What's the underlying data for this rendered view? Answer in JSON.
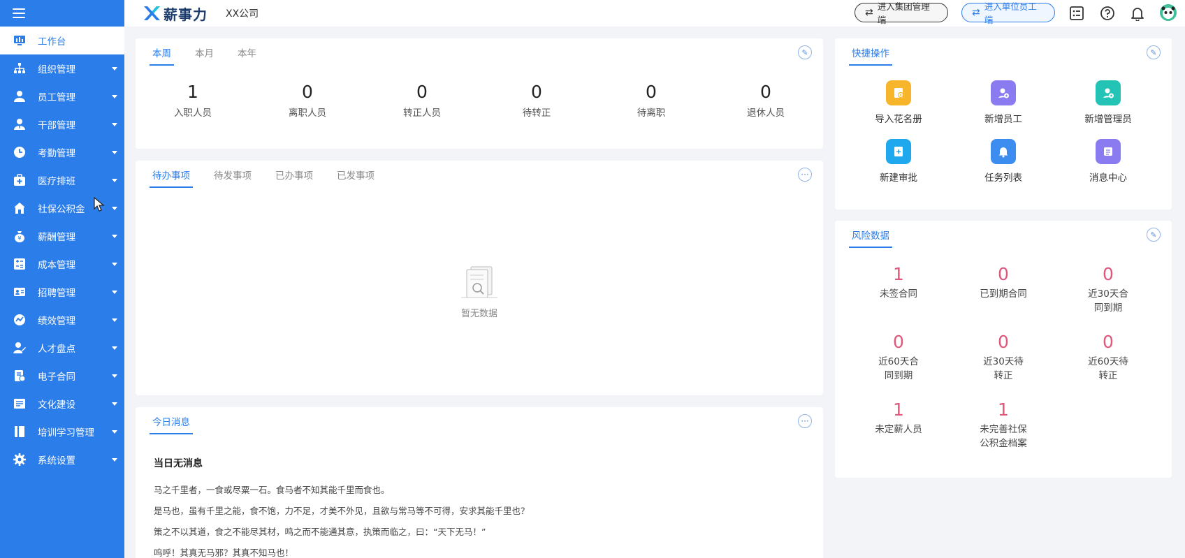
{
  "header": {
    "logo_text": "薪事力",
    "company": "XX公司",
    "btn_group": "进入集团管理端",
    "btn_unit": "进入单位员工端"
  },
  "sidebar": {
    "items": [
      {
        "label": "工作台",
        "icon": "dashboard-icon"
      },
      {
        "label": "组织管理",
        "icon": "org-chart-icon"
      },
      {
        "label": "员工管理",
        "icon": "user-icon"
      },
      {
        "label": "干部管理",
        "icon": "cadre-icon"
      },
      {
        "label": "考勤管理",
        "icon": "clock-icon"
      },
      {
        "label": "医疗排班",
        "icon": "medical-icon"
      },
      {
        "label": "社保公积金",
        "icon": "house-icon"
      },
      {
        "label": "薪酬管理",
        "icon": "money-bag-icon"
      },
      {
        "label": "成本管理",
        "icon": "calculator-icon"
      },
      {
        "label": "招聘管理",
        "icon": "recruit-icon"
      },
      {
        "label": "绩效管理",
        "icon": "performance-icon"
      },
      {
        "label": "人才盘点",
        "icon": "talent-icon"
      },
      {
        "label": "电子合同",
        "icon": "contract-icon"
      },
      {
        "label": "文化建设",
        "icon": "culture-icon"
      },
      {
        "label": "培训学习管理",
        "icon": "book-icon"
      },
      {
        "label": "系统设置",
        "icon": "gear-icon"
      }
    ]
  },
  "stats_card": {
    "tabs": [
      "本周",
      "本月",
      "本年"
    ],
    "items": [
      {
        "value": "1",
        "label": "入职人员"
      },
      {
        "value": "0",
        "label": "离职人员"
      },
      {
        "value": "0",
        "label": "转正人员"
      },
      {
        "value": "0",
        "label": "待转正"
      },
      {
        "value": "0",
        "label": "待离职"
      },
      {
        "value": "0",
        "label": "退休人员"
      }
    ]
  },
  "todo_card": {
    "tabs": [
      "待办事项",
      "待发事项",
      "已办事项",
      "已发事项"
    ],
    "empty_text": "暂无数据"
  },
  "message_card": {
    "tab": "今日消息",
    "title": "当日无消息",
    "lines": [
      "马之千里者，一食或尽粟一石。食马者不知其能千里而食也。",
      "是马也，虽有千里之能，食不饱，力不足，才美不外见，且欲与常马等不可得，安求其能千里也？",
      "策之不以其道，食之不能尽其材，鸣之而不能通其意，执策而临之，曰：“天下无马！”",
      "呜呼！其真无马邪？其真不知马也！"
    ]
  },
  "quick_card": {
    "tab": "快捷操作",
    "items": [
      {
        "label": "导入花名册",
        "color": "#f7b52c",
        "icon": "import-icon"
      },
      {
        "label": "新增员工",
        "color": "#8a7cf0",
        "icon": "add-user-icon"
      },
      {
        "label": "新增管理员",
        "color": "#23c3b6",
        "icon": "add-admin-icon"
      },
      {
        "label": "新建审批",
        "color": "#1fa8ee",
        "icon": "new-approval-icon"
      },
      {
        "label": "任务列表",
        "color": "#3d8cf0",
        "icon": "bell-icon"
      },
      {
        "label": "消息中心",
        "color": "#8a7cf0",
        "icon": "message-center-icon"
      }
    ]
  },
  "risk_card": {
    "tab": "风险数据",
    "items": [
      {
        "value": "1",
        "label": "未签合同"
      },
      {
        "value": "0",
        "label": "已到期合同"
      },
      {
        "value": "0",
        "label": "近30天合同到期"
      },
      {
        "value": "0",
        "label": "近60天合同到期"
      },
      {
        "value": "0",
        "label": "近30天待转正"
      },
      {
        "value": "0",
        "label": "近60天待转正"
      },
      {
        "value": "1",
        "label": "未定薪人员"
      },
      {
        "value": "1",
        "label": "未完善社保公积金档案"
      }
    ]
  },
  "colors": {
    "primary": "#2b7de9",
    "risk_number": "#e0577c"
  }
}
